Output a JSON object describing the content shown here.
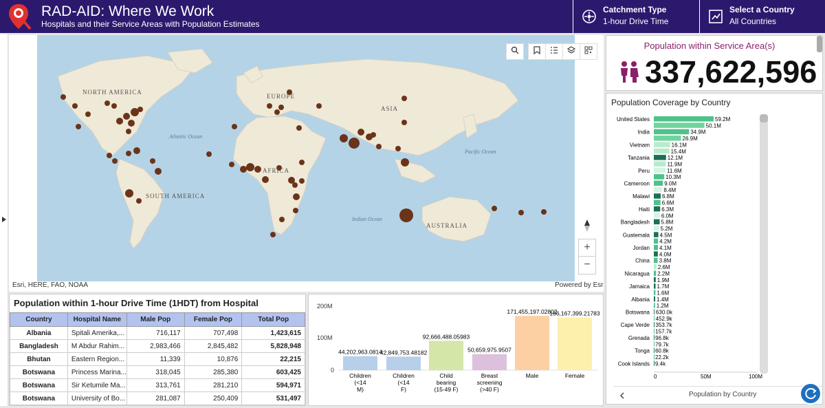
{
  "header": {
    "title": "RAD-AID: Where We Work",
    "subtitle": "Hospitals and their Service Areas with Population Estimates",
    "catchment": {
      "label": "Catchment Type",
      "value": "1-hour Drive Time"
    },
    "country_select": {
      "label": "Select a Country",
      "value": "All Countries"
    }
  },
  "map": {
    "attribution": "Esri, HERE, FAO, NOAA",
    "powered_by": "Powered by Esri",
    "labels": {
      "north_america": "NORTH AMERICA",
      "south_america": "SOUTH AMERICA",
      "europe": "EUROPE",
      "asia": "ASIA",
      "africa": "AFRICA",
      "australia": "AUSTRALIA",
      "atlantic": "Atlantic Ocean",
      "pacific_left": "Pacific Ocean",
      "pacific_right": "Pacific Ocean",
      "pacific_far": "Pacific Ocean",
      "indian": "Indian Ocean"
    },
    "tools": {
      "search": "search-icon",
      "bookmark": "bookmark-icon",
      "legend": "legend-list-icon",
      "layers": "layers-icon",
      "qr": "qr-code-icon"
    },
    "zoom_in": "+",
    "zoom_out": "−"
  },
  "population": {
    "title": "Population within Service Area(s)",
    "value": "337,622,596"
  },
  "coverage": {
    "title": "Population Coverage by Country",
    "footer": "Population by Country",
    "x_ticks": [
      "0",
      "50M",
      "100M"
    ]
  },
  "table": {
    "title": "Population within 1-hour Drive Time (1HDT) from Hospital",
    "columns": [
      "Country",
      "Hospital Name",
      "Male Pop",
      "Female Pop",
      "Total Pop"
    ],
    "rows": [
      [
        "Albania",
        "Spitali Amerika,...",
        "716,117",
        "707,498",
        "1,423,615"
      ],
      [
        "Bangladesh",
        "M Abdur Rahim...",
        "2,983,466",
        "2,845,482",
        "5,828,948"
      ],
      [
        "Bhutan",
        "Eastern Region...",
        "11,339",
        "10,876",
        "22,215"
      ],
      [
        "Botswana",
        "Princess Marina...",
        "318,045",
        "285,380",
        "603,425"
      ],
      [
        "Botswana",
        "Sir Ketumile Ma...",
        "313,761",
        "281,210",
        "594,971"
      ],
      [
        "Botswana",
        "University of Bo...",
        "281,087",
        "250,409",
        "531,497"
      ]
    ]
  },
  "chart_data": [
    {
      "type": "bar",
      "orientation": "vertical",
      "categories": [
        "Children (<14 M)",
        "Children (<14 F)",
        "Child bearing (15-49 F)",
        "Breast screening (>40 F)",
        "Male",
        "Female"
      ],
      "values": [
        44202963.0814,
        42849753.48182,
        92666488.05983,
        50659975.9507,
        171455197.02802,
        166167399.21783
      ],
      "data_labels": [
        "44,202,963.0814",
        "42,849,753.48182",
        "92,666,488.05983",
        "50,659,975.9507",
        "171,455,197.02802",
        "166,167,399.21783"
      ],
      "colors": [
        "#b7cfe9",
        "#b7cfe9",
        "#d4e6a8",
        "#dcc0dd",
        "#fdd0a4",
        "#fdf0ad"
      ],
      "y_ticks": [
        "0",
        "100M",
        "200M"
      ],
      "ylim": [
        0,
        200000000
      ]
    },
    {
      "type": "bar",
      "orientation": "horizontal",
      "title": "Population Coverage by Country",
      "xlim": [
        0,
        100000000
      ],
      "categories": [
        "United States",
        "",
        "India",
        "",
        "Vietnam",
        "",
        "Tanzania",
        "",
        "Peru",
        "",
        "Cameroon",
        "",
        "Malawi",
        "",
        "Haiti",
        "",
        "Bangladesh",
        "",
        "Guatemala",
        "",
        "Jordan",
        "",
        "China",
        "",
        "Nicaragua",
        "",
        "Jamaica",
        "",
        "Albania",
        "",
        "Botswana",
        "",
        "Cape Verde",
        "",
        "Grenada",
        "",
        "Tonga",
        "",
        "Cook Islands",
        ""
      ],
      "values": [
        59200000,
        50100000,
        34900000,
        26900000,
        16100000,
        15400000,
        12100000,
        11900000,
        11600000,
        10300000,
        9000000,
        8400000,
        6800000,
        6600000,
        6300000,
        6000000,
        5800000,
        5200000,
        4500000,
        4200000,
        4100000,
        4000000,
        3800000,
        2600000,
        2200000,
        1900000,
        1700000,
        1600000,
        1400000,
        1200000,
        630000,
        452900,
        353700,
        157700,
        96800,
        79700,
        60800,
        22200,
        9400,
        0
      ],
      "data_labels": [
        "59.2M",
        "50.1M",
        "34.9M",
        "26.9M",
        "16.1M",
        "15.4M",
        "12.1M",
        "11.9M",
        "11.6M",
        "10.3M",
        "9.0M",
        "8.4M",
        "6.8M",
        "6.6M",
        "6.3M",
        "6.0M",
        "5.8M",
        "5.2M",
        "4.5M",
        "4.2M",
        "4.1M",
        "4.0M",
        "3.8M",
        "2.6M",
        "2.2M",
        "1.9M",
        "1.7M",
        "1.6M",
        "1.4M",
        "1.2M",
        "630.0k",
        "452.9k",
        "353.7k",
        "157.7k",
        "96.8k",
        "79.7k",
        "60.8k",
        "22.2k",
        "9.4k",
        ""
      ],
      "shades": [
        "#4dc28a",
        "#71d39e",
        "#4dc28a",
        "#71d39e",
        "#b8ebcd",
        "#b8ebcd",
        "#1f6f58",
        "#b8ebcd",
        "#d5f4e2",
        "#4dc28a",
        "#4dc28a",
        "#d5f4e2",
        "#1f6f58",
        "#4dc28a",
        "#1f6f58",
        "#d5f4e2",
        "#1f6f58",
        "#d5f4e2",
        "#1f6f58",
        "#4dc28a",
        "#4dc28a",
        "#1f6f58",
        "#4dc28a",
        "#b8ebcd",
        "#4dc28a",
        "#1f6f58",
        "#1f6f58",
        "#4dc28a",
        "#1f6f58",
        "#4dc28a",
        "#1f6f58",
        "#4dc28a",
        "#1f6f58",
        "#4dc28a",
        "#1f6f58",
        "#4dc28a",
        "#1f6f58",
        "#4dc28a",
        "#1f6f58",
        "#4dc28a"
      ]
    }
  ],
  "colors": {
    "header_bg": "#2c196e",
    "accent": "#8b1f6a",
    "marker": "#6b3419",
    "land": "#efe9d8",
    "ocean": "#b5d3e7",
    "table_header": "#b3c3f0"
  }
}
